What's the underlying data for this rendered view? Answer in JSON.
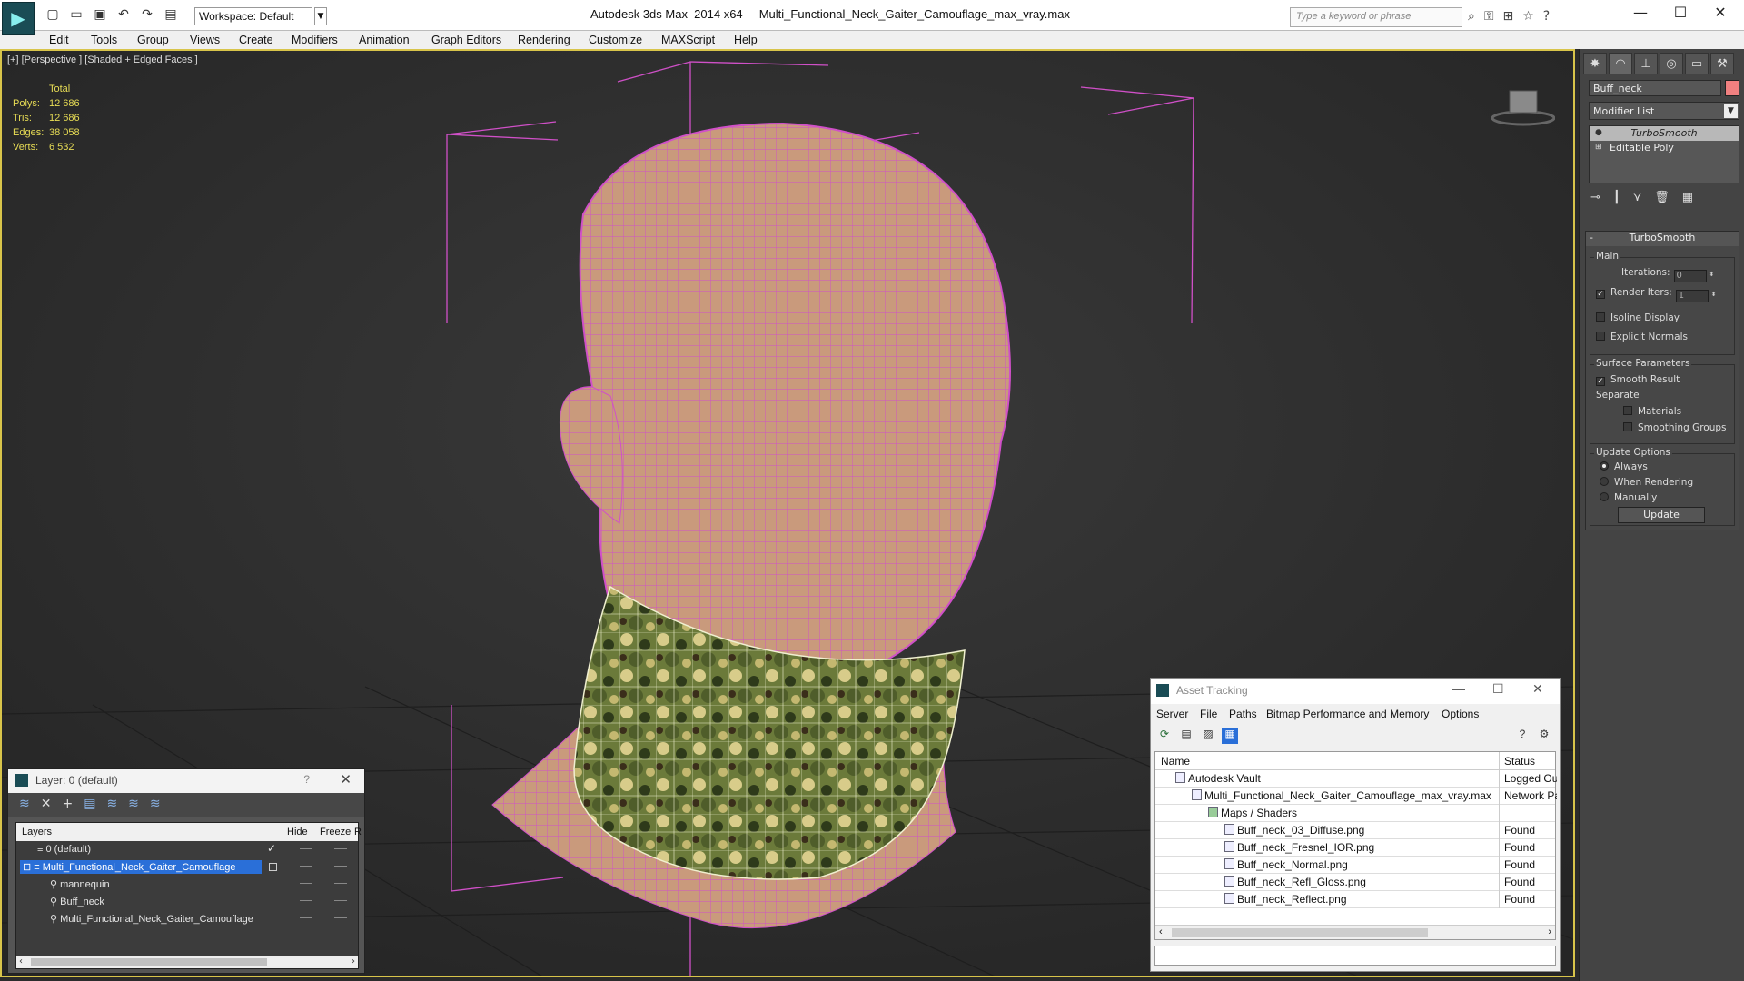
{
  "app": {
    "logo": "3ds-max-logo",
    "title": "Autodesk 3ds Max  2014 x64     Multi_Functional_Neck_Gaiter_Camouflage_max_vray.max",
    "workspace": "Workspace: Default",
    "search_placeholder": "Type a keyword or phrase"
  },
  "menus": [
    "Edit",
    "Tools",
    "Group",
    "Views",
    "Create",
    "Modifiers",
    "Animation",
    "Graph Editors",
    "Rendering",
    "Customize",
    "MAXScript",
    "Help"
  ],
  "viewport": {
    "label": "[+] [Perspective ] [Shaded + Edged Faces ]",
    "stats": {
      "header": "Total",
      "rows": [
        {
          "label": "Polys:",
          "value": "12 686"
        },
        {
          "label": "Tris:",
          "value": "12 686"
        },
        {
          "label": "Edges:",
          "value": "38 058"
        },
        {
          "label": "Verts:",
          "value": "6 532"
        }
      ]
    },
    "colors": {
      "border": "#d8c44a",
      "wire": "#d050c8",
      "skin": "#c99a7c",
      "stats": "#e8dd55"
    }
  },
  "command_panel": {
    "object_name": "Buff_neck",
    "object_color": "#f08080",
    "modifier_list": "Modifier List",
    "stack": [
      "TurboSmooth",
      "Editable Poly"
    ],
    "turbosmooth": {
      "title": "TurboSmooth",
      "main_group": "Main",
      "iterations_label": "Iterations:",
      "iterations_value": "0",
      "render_iters_label": "Render Iters:",
      "render_iters_value": "1",
      "isoline": "Isoline Display",
      "explicit_normals": "Explicit Normals",
      "surface_group": "Surface Parameters",
      "smooth_result": "Smooth Result",
      "separate": "Separate",
      "materials": "Materials",
      "smoothing_groups": "Smoothing Groups",
      "update_group": "Update Options",
      "always": "Always",
      "when_rendering": "When Rendering",
      "manually": "Manually",
      "update_button": "Update"
    }
  },
  "layer_window": {
    "title": "Layer: 0 (default)",
    "help": "?",
    "columns": {
      "layers": "Layers",
      "hide": "Hide",
      "freeze": "Freeze",
      "extra": "R"
    },
    "rows": [
      {
        "name": "0 (default)",
        "indent": 1
      },
      {
        "name": "Multi_Functional_Neck_Gaiter_Camouflage",
        "indent": 1
      },
      {
        "name": "mannequin",
        "indent": 2
      },
      {
        "name": "Buff_neck",
        "indent": 2
      },
      {
        "name": "Multi_Functional_Neck_Gaiter_Camouflage",
        "indent": 2
      }
    ]
  },
  "asset_window": {
    "title": "Asset Tracking",
    "menus": [
      "Server",
      "File",
      "Paths",
      "Bitmap Performance and Memory",
      "Options"
    ],
    "columns": {
      "name": "Name",
      "status": "Status"
    },
    "rows": [
      {
        "name": "Autodesk Vault",
        "status": "Logged Ou",
        "indent": 1
      },
      {
        "name": "Multi_Functional_Neck_Gaiter_Camouflage_max_vray.max",
        "status": "Network Pa",
        "indent": 2
      },
      {
        "name": "Maps / Shaders",
        "status": "",
        "indent": 3
      },
      {
        "name": "Buff_neck_03_Diffuse.png",
        "status": "Found",
        "indent": 4
      },
      {
        "name": "Buff_neck_Fresnel_IOR.png",
        "status": "Found",
        "indent": 4
      },
      {
        "name": "Buff_neck_Normal.png",
        "status": "Found",
        "indent": 4
      },
      {
        "name": "Buff_neck_Refl_Gloss.png",
        "status": "Found",
        "indent": 4
      },
      {
        "name": "Buff_neck_Reflect.png",
        "status": "Found",
        "indent": 4
      }
    ]
  }
}
